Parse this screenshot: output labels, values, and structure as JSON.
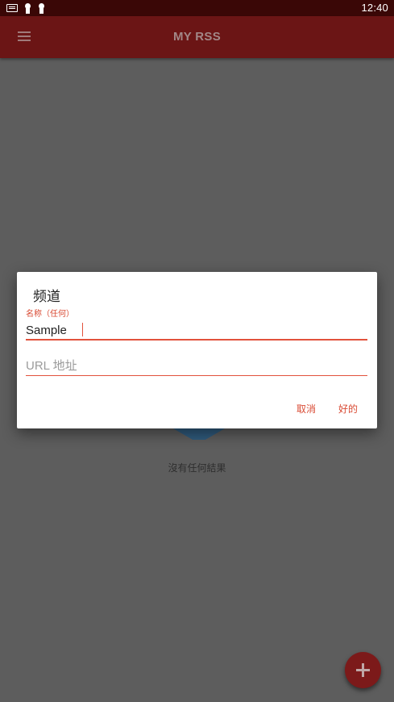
{
  "status_bar": {
    "time": "12:40"
  },
  "app_bar": {
    "title": "MY RSS"
  },
  "empty_state": {
    "text": "沒有任何結果"
  },
  "dialog": {
    "title": "频道",
    "name_field": {
      "label": "名称（任何）",
      "value": "Sample"
    },
    "url_field": {
      "placeholder": "URL 地址",
      "value": ""
    },
    "cancel_label": "取消",
    "ok_label": "好的"
  },
  "colors": {
    "app_bar": "#6b1515",
    "status_bar": "#3a0706",
    "accent": "#e2523c",
    "fab": "#7c1a1a",
    "scrim_background": "#5d5d5d"
  }
}
